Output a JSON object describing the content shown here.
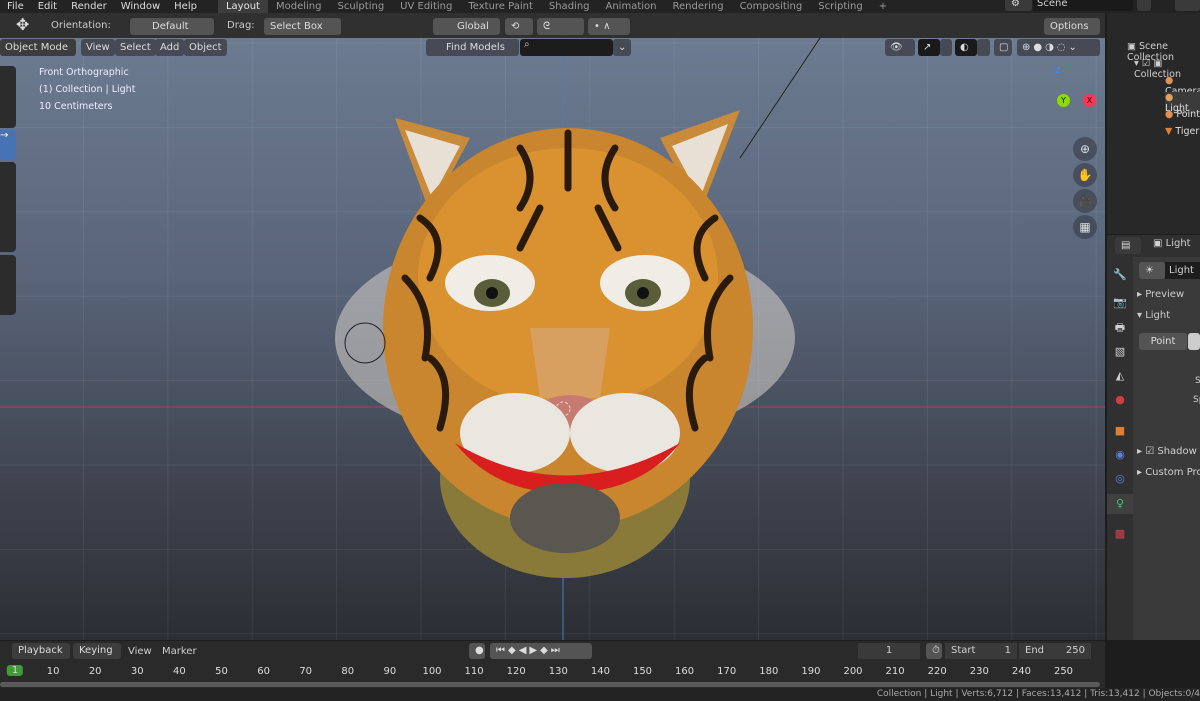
{
  "menu": [
    "File",
    "Edit",
    "Render",
    "Window",
    "Help"
  ],
  "workspaces": [
    "Layout",
    "Modeling",
    "Sculpting",
    "UV Editing",
    "Texture Paint",
    "Shading",
    "Animation",
    "Rendering",
    "Compositing",
    "Scripting",
    "+"
  ],
  "active_workspace": "Layout",
  "scene": "Scene",
  "toolbar": {
    "orientation_label": "Orientation:",
    "orientation_value": "Default",
    "drag_label": "Drag:",
    "drag_value": "Select Box",
    "transform_orientation": "Global",
    "options": "Options"
  },
  "viewport_header": {
    "mode": "Object Mode",
    "menus": [
      "View",
      "Select",
      "Add",
      "Object"
    ],
    "find_models": "Find Models",
    "search_placeholder": ""
  },
  "viewport_overlay": {
    "view": "Front Orthographic",
    "collection": "(1) Collection | Light",
    "scale": "10 Centimeters"
  },
  "gizmo": {
    "z": "Z",
    "y": "Y",
    "x": "X"
  },
  "outliner": {
    "root": "Scene Collection",
    "collection": "Collection",
    "items": [
      "Camera",
      "Light",
      "Point",
      "Tiger"
    ]
  },
  "properties": {
    "object": "Light",
    "data_name": "Light",
    "panels": {
      "preview": "Preview",
      "light": "Light",
      "type": "Point",
      "strength": "Strength",
      "specular": "Specular",
      "shadow": "Shadow",
      "custom": "Custom Properties"
    }
  },
  "timeline": {
    "menus": [
      "Playback",
      "Keying",
      "View",
      "Marker"
    ],
    "current_frame": "1",
    "start_label": "Start",
    "start": "1",
    "end_label": "End",
    "end": "250",
    "frames": [
      "1",
      "10",
      "20",
      "30",
      "40",
      "50",
      "60",
      "70",
      "80",
      "90",
      "100",
      "110",
      "120",
      "130",
      "140",
      "150",
      "160",
      "170",
      "180",
      "190",
      "200",
      "210",
      "220",
      "230",
      "240",
      "250"
    ]
  },
  "status": "Collection | Light | Verts:6,712 | Faces:13,412 | Tris:13,412 | Objects:0/4",
  "colors": {
    "accent": "#4772b3",
    "frame_green": "#3f9c35",
    "x_axis": "#ff3352",
    "y_axis": "#8bdc00",
    "z_axis": "#2890ff"
  }
}
